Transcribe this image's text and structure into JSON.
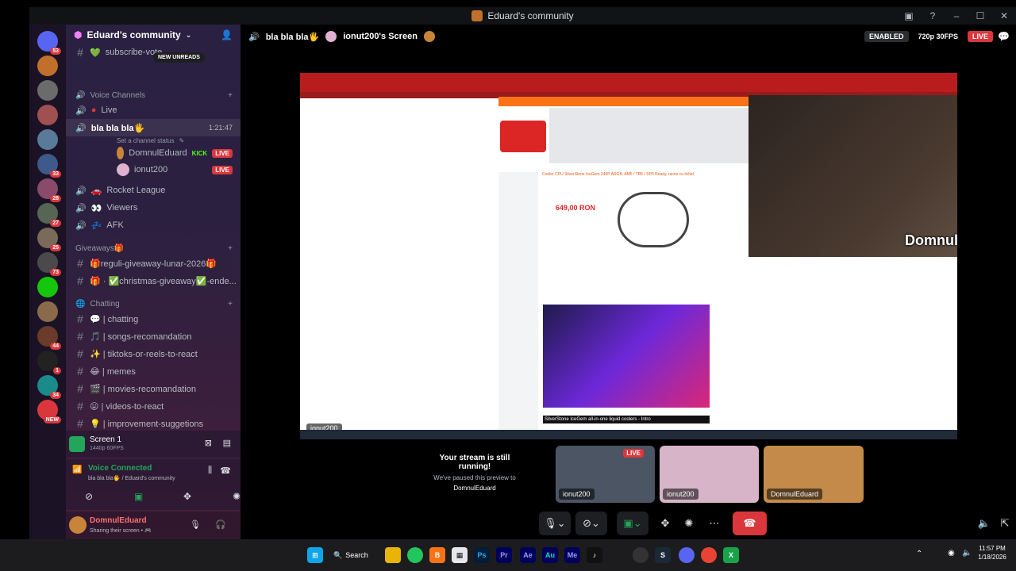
{
  "window": {
    "title": "Eduard's community"
  },
  "titlebar_icons": [
    "inbox-icon",
    "help-icon",
    "minimize-icon",
    "maximize-icon",
    "close-icon"
  ],
  "servers": [
    {
      "badge": "53",
      "color": "#5865f2"
    },
    {
      "badge": "",
      "color": "#c0702a"
    },
    {
      "badge": "",
      "color": "#6b6b6b"
    },
    {
      "badge": "",
      "color": "#a05050"
    },
    {
      "badge": "",
      "color": "#5a7a9a"
    },
    {
      "badge": "33",
      "color": "#3d5a8a"
    },
    {
      "badge": "28",
      "color": "#8a4a6a"
    },
    {
      "badge": "27",
      "color": "#556655"
    },
    {
      "badge": "25",
      "color": "#7a6a5a"
    },
    {
      "badge": "73",
      "color": "#4a4a4a"
    },
    {
      "badge": "",
      "color": "#16c60c"
    },
    {
      "badge": "",
      "color": "#8a6a4a"
    },
    {
      "badge": "44",
      "color": "#6a3a2a"
    },
    {
      "badge": "1",
      "color": "#222222"
    },
    {
      "badge": "34",
      "color": "#1a8a8a"
    },
    {
      "badge": "NEW",
      "color": "#da373c"
    }
  ],
  "guild": {
    "name": "Eduard's community",
    "new_unreads": "NEW UNREADS"
  },
  "channels": {
    "top_partial": "subscribe-vote",
    "voice_category": "Voice Channels",
    "live": "Live",
    "current_voice": "bla bla bla🖐",
    "current_timer": "1:21:47",
    "set_status": "Set a channel status",
    "members": [
      {
        "name": "DomnulEduard",
        "tag": "KICK",
        "live": "LIVE"
      },
      {
        "name": "ionut200",
        "tag": "",
        "live": "LIVE"
      }
    ],
    "rocket": "Rocket League",
    "viewers": "Viewers",
    "afk": "AFK",
    "giveaways_category": "Giveaways🎁",
    "giveaway1": "🎁reguli-giveaway-lunar-2026🎁",
    "giveaway2": "🎁 · ✅christmas-giveaway✅-ende...",
    "chatting_category": "Chatting",
    "text": [
      "💬 | chatting",
      "🎵 | songs-recomandation",
      "✨ | tiktoks-or-reels-to-react",
      "😂 | memes",
      "🎬 | movies-recomandation",
      "😛 | videos-to-react",
      "💡 | improvement-suggetions"
    ]
  },
  "screen_panel": {
    "title": "Screen 1",
    "sub": "1440p 60FPS"
  },
  "voice_panel": {
    "status": "Voice Connected",
    "sub": "bla bla bla🖐 / Eduard's community"
  },
  "user_panel": {
    "name": "DomnulEduard",
    "status": "Sharing their screen • 🎮"
  },
  "call": {
    "channel": "bla bla bla🖐",
    "screen_owner": "ionut200's Screen",
    "enabled": "ENABLED",
    "quality": "720p 30FPS",
    "live": "LIVE"
  },
  "stream": {
    "site_price": "649,00 RON",
    "site_title": "Cooler CPU SilverStone IceGem 240P ARGB, AM5 / TR5 / SP6 Ready, racire cu lichid",
    "cam_name": "DomnulEduard",
    "screen_label": "ionut200",
    "tab_title": "SilverStone IceGem all-in-one liquid coolers - Intro"
  },
  "tiles": {
    "notice_title": "Your stream is still running!",
    "notice_sub": "We've paused this preview to",
    "notice_label": "DomnulEduard",
    "t1_label": "ionut200",
    "t2_label": "ionut200",
    "t3_label": "DomnulEduard",
    "live": "LIVE"
  },
  "win_taskbar": {
    "search": "Search",
    "time": "11:57 PM",
    "date": "1/18/2026"
  }
}
